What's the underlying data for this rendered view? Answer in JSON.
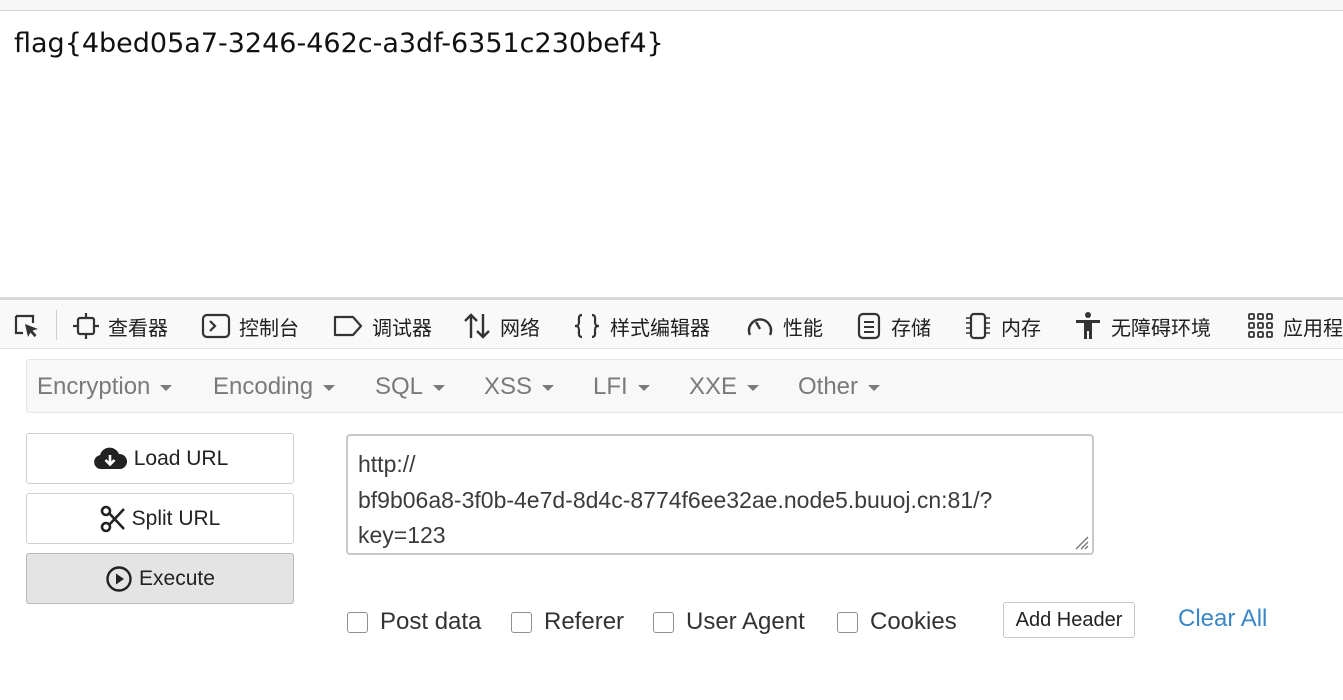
{
  "page": {
    "flag": "flag{4bed05a7-3246-462c-a3df-6351c230bef4}"
  },
  "devtools": {
    "picker_icon": "element-picker-icon",
    "tabs": [
      {
        "label": "查看器",
        "icon": "inspector-icon"
      },
      {
        "label": "控制台",
        "icon": "console-icon"
      },
      {
        "label": "调试器",
        "icon": "debugger-icon"
      },
      {
        "label": "网络",
        "icon": "network-icon"
      },
      {
        "label": "样式编辑器",
        "icon": "style-editor-icon"
      },
      {
        "label": "性能",
        "icon": "performance-icon"
      },
      {
        "label": "存储",
        "icon": "storage-icon"
      },
      {
        "label": "内存",
        "icon": "memory-icon"
      },
      {
        "label": "无障碍环境",
        "icon": "accessibility-icon"
      },
      {
        "label": "应用程",
        "icon": "application-icon"
      }
    ]
  },
  "hackbar": {
    "menu": [
      "Encryption",
      "Encoding",
      "SQL",
      "XSS",
      "LFI",
      "XXE",
      "Other"
    ],
    "buttons": {
      "load_url": "Load URL",
      "split_url": "Split URL",
      "execute": "Execute"
    },
    "url_lines": [
      "http://",
      "bf9b06a8-3f0b-4e7d-8d4c-8774f6ee32ae.node5.buuoj.cn:81/?",
      "key=123"
    ],
    "options": {
      "post_data": "Post data",
      "referer": "Referer",
      "user_agent": "User Agent",
      "cookies": "Cookies"
    },
    "add_header": "Add Header",
    "clear_all": "Clear All",
    "colors": {
      "menu_text": "#7a7a7a",
      "link": "#3a87c8",
      "active_button_bg": "#e4e4e4"
    }
  }
}
